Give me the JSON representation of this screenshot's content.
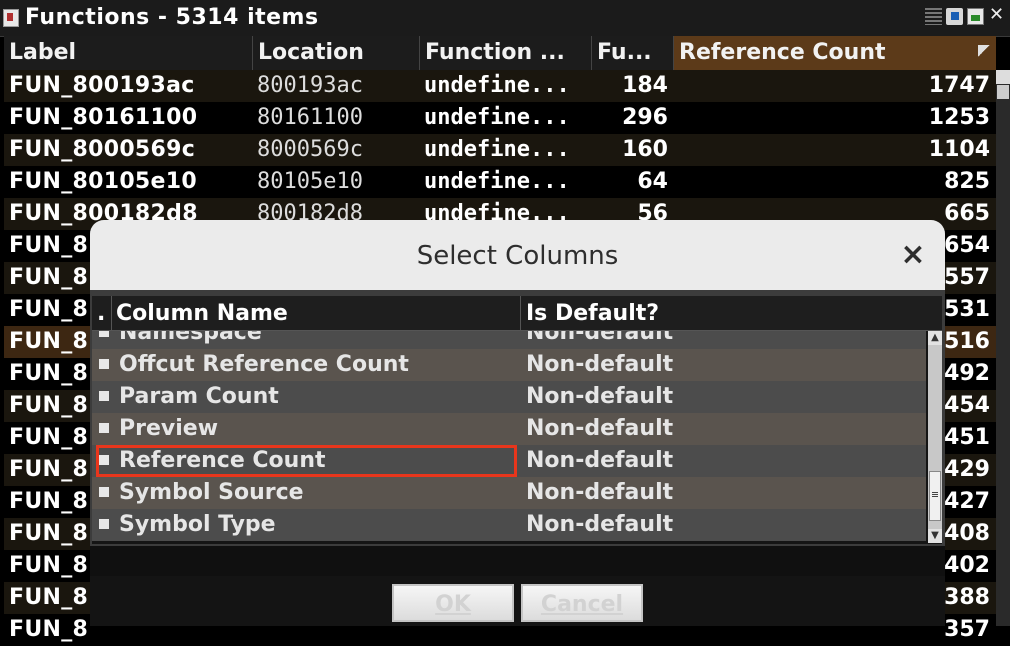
{
  "window": {
    "title": "Functions - 5314 items",
    "close_glyph": "✕"
  },
  "table": {
    "columns": [
      "Label",
      "Location",
      "Function ...",
      "Fu...",
      "Reference Count"
    ],
    "sorted_column": "Reference Count",
    "rows": [
      {
        "label": "FUN_800193ac",
        "location": "800193ac",
        "function": "undefine...",
        "fu": "184",
        "ref": "1747"
      },
      {
        "label": "FUN_80161100",
        "location": "80161100",
        "function": "undefine...",
        "fu": "296",
        "ref": "1253"
      },
      {
        "label": "FUN_8000569c",
        "location": "8000569c",
        "function": "undefine...",
        "fu": "160",
        "ref": "1104"
      },
      {
        "label": "FUN_80105e10",
        "location": "80105e10",
        "function": "undefine...",
        "fu": "64",
        "ref": "825"
      },
      {
        "label": "FUN_800182d8",
        "location": "800182d8",
        "function": "undefine...",
        "fu": "56",
        "ref": "665"
      },
      {
        "label": "FUN_8",
        "location": "",
        "function": "",
        "fu": "",
        "ref": "654"
      },
      {
        "label": "FUN_8",
        "location": "",
        "function": "",
        "fu": "",
        "ref": "557"
      },
      {
        "label": "FUN_8",
        "location": "",
        "function": "",
        "fu": "",
        "ref": "531"
      },
      {
        "label": "FUN_8",
        "location": "",
        "function": "",
        "fu": "",
        "ref": "516"
      },
      {
        "label": "FUN_8",
        "location": "",
        "function": "",
        "fu": "",
        "ref": "492"
      },
      {
        "label": "FUN_8",
        "location": "",
        "function": "",
        "fu": "",
        "ref": "454"
      },
      {
        "label": "FUN_8",
        "location": "",
        "function": "",
        "fu": "",
        "ref": "451"
      },
      {
        "label": "FUN_8",
        "location": "",
        "function": "",
        "fu": "",
        "ref": "429"
      },
      {
        "label": "FUN_8",
        "location": "",
        "function": "",
        "fu": "",
        "ref": "427"
      },
      {
        "label": "FUN_8",
        "location": "",
        "function": "",
        "fu": "",
        "ref": "408"
      },
      {
        "label": "FUN_8",
        "location": "",
        "function": "",
        "fu": "",
        "ref": "402"
      },
      {
        "label": "FUN_8",
        "location": "",
        "function": "",
        "fu": "",
        "ref": "388"
      },
      {
        "label": "FUN_8",
        "location": "",
        "function": "",
        "fu": "",
        "ref": "357"
      }
    ],
    "selected_row_index": 8
  },
  "dialog": {
    "title": "Select Columns",
    "close_glyph": "×",
    "list_headers": {
      "checkbox": ".",
      "name": "Column Name",
      "default": "Is Default?"
    },
    "columns": [
      {
        "name": "Namespace",
        "default": "Non-default"
      },
      {
        "name": "Offcut Reference Count",
        "default": "Non-default"
      },
      {
        "name": "Param Count",
        "default": "Non-default"
      },
      {
        "name": "Preview",
        "default": "Non-default"
      },
      {
        "name": "Reference Count",
        "default": "Non-default"
      },
      {
        "name": "Symbol Source",
        "default": "Non-default"
      },
      {
        "name": "Symbol Type",
        "default": "Non-default"
      }
    ],
    "highlighted_index": 4,
    "ok_label": "OK",
    "cancel_label": "Cancel"
  }
}
